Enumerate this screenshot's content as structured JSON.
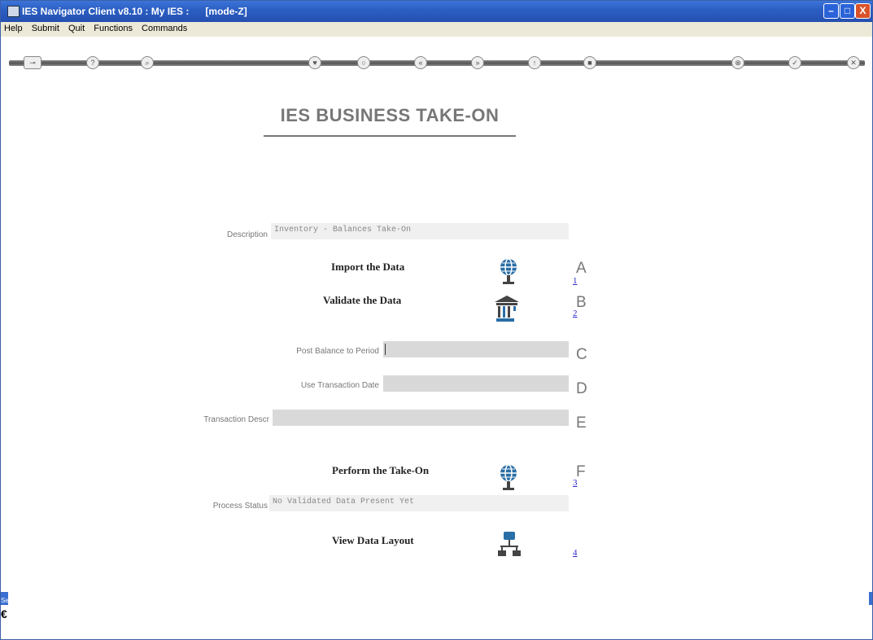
{
  "window": {
    "title": "IES Navigator Client v8.10 : My IES :      [mode-Z]",
    "controls": {
      "minimize": "–",
      "maximize": "□",
      "close": "X"
    }
  },
  "menu": {
    "items": [
      "Help",
      "Submit",
      "Quit",
      "Functions",
      "Commands"
    ]
  },
  "toolbar": {
    "buttons": [
      "key-icon",
      "help-icon",
      "search-icon",
      "heart-icon",
      "circle-icon",
      "rewind-icon",
      "forward-icon",
      "up-icon",
      "stop-icon",
      "cancel-icon",
      "ok-icon",
      "close-icon"
    ]
  },
  "page": {
    "heading": "IES BUSINESS TAKE-ON",
    "description_label": "Description",
    "description_value": "Inventory - Balances Take-On",
    "actions": [
      {
        "label": "Import the Data",
        "letter": "A",
        "num": "1"
      },
      {
        "label": "Validate the Data",
        "letter": "B",
        "num": "2"
      },
      {
        "label": "Perform the Take-On",
        "letter": "F",
        "num": "3"
      },
      {
        "label": "View Data Layout",
        "num": "4"
      }
    ],
    "fields": {
      "post_balance_label": "Post Balance to Period",
      "post_balance_value": "",
      "post_balance_letter": "C",
      "use_trans_date_label": "Use Transaction Date",
      "use_trans_date_value": "",
      "use_trans_date_letter": "D",
      "trans_descr_label": "Transaction Descr",
      "trans_descr_value": "",
      "trans_descr_letter": "E"
    },
    "process_status_label": "Process Status",
    "process_status_value": "No Validated Data Present Yet"
  },
  "side": {
    "left_tab": "Set",
    "left_glyph": "€"
  },
  "colors": {
    "title_bar": "#2c5fc4",
    "link": "#2b2bc8",
    "icon_blue": "#2a6ea6"
  }
}
